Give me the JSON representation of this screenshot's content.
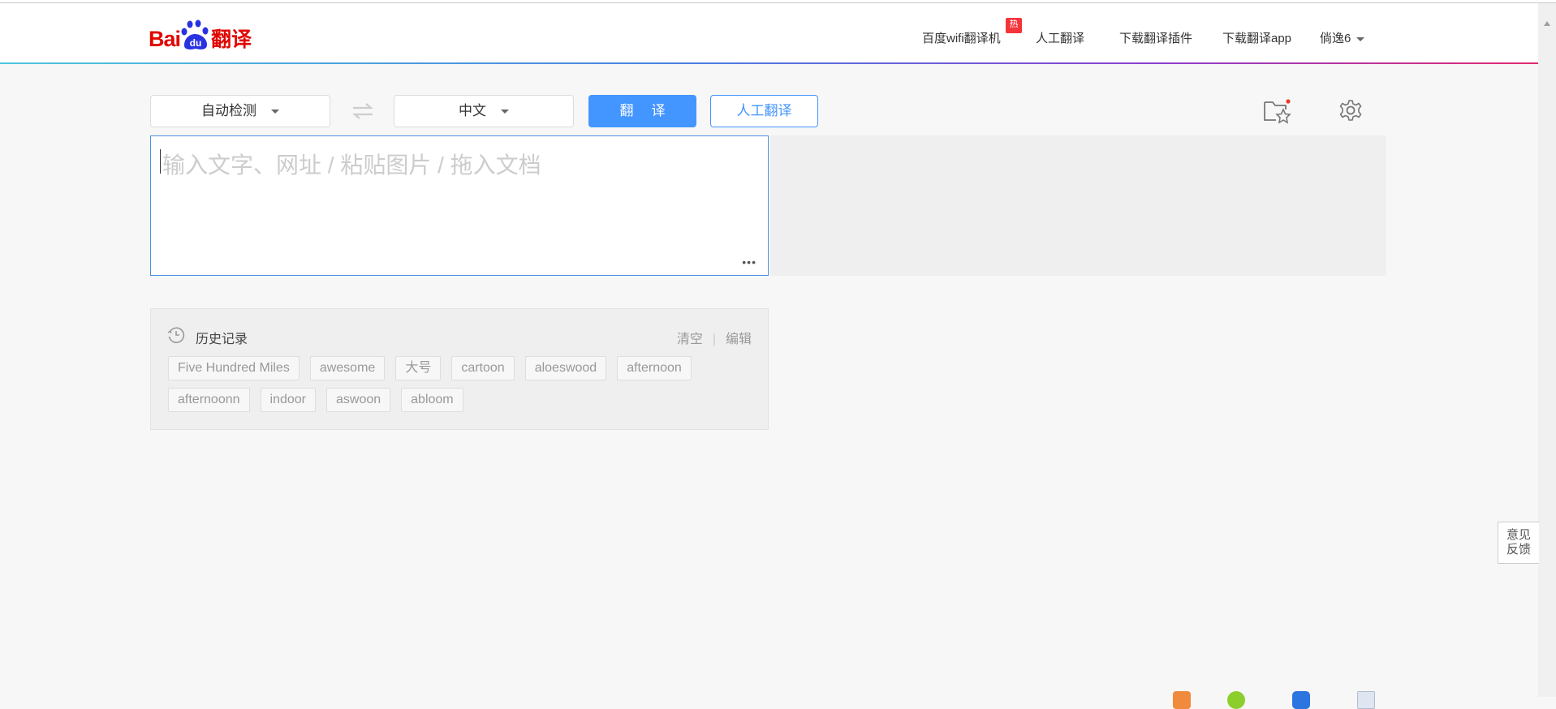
{
  "header": {
    "logo_text": "Bai du 翻译",
    "logo_bai": "Bai",
    "logo_fy": "翻译",
    "nav": [
      {
        "label": "百度wifi翻译机",
        "badge": "热"
      },
      {
        "label": "人工翻译"
      },
      {
        "label": "下载翻译插件"
      },
      {
        "label": "下载翻译app"
      },
      {
        "label": "倘逸6"
      }
    ]
  },
  "toolbar": {
    "source_lang": "自动检测",
    "target_lang": "中文",
    "translate_label": "翻译",
    "human_translate_label": "人工翻译"
  },
  "input": {
    "placeholder": "输入文字、网址 / 粘贴图片 / 拖入文档",
    "value": "",
    "more": "•••"
  },
  "history": {
    "title": "历史记录",
    "clear": "清空",
    "separator": "|",
    "edit": "编辑",
    "rows": [
      [
        "Five Hundred Miles",
        "awesome",
        "大号",
        "cartoon",
        "aloeswood",
        "afternoon"
      ],
      [
        "afternoonn",
        "indoor",
        "aswoon",
        "abloom"
      ]
    ]
  },
  "feedback": {
    "line1": "意见",
    "line2": "反馈"
  },
  "colors": {
    "brand_red": "#e10602",
    "accent_blue": "#4395ff",
    "hot_badge": "#f5343a"
  }
}
